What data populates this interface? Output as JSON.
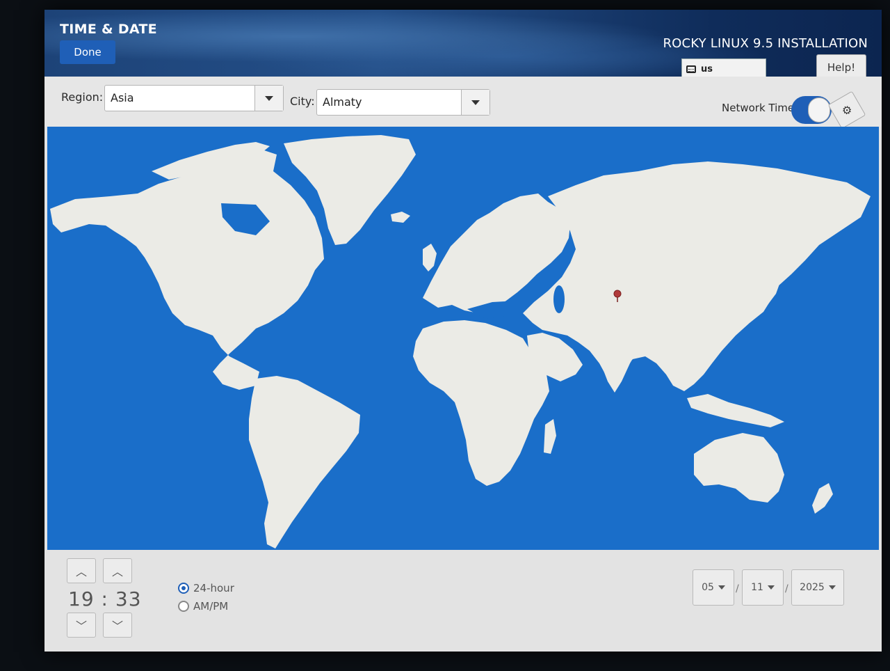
{
  "header": {
    "title": "TIME & DATE",
    "done_label": "Done",
    "product": "ROCKY LINUX 9.5 INSTALLATION",
    "keyboard_layout": "us",
    "help_label": "Help!"
  },
  "toolbar": {
    "region_label": "Region:",
    "region_value": "Asia",
    "city_label": "City:",
    "city_value": "Almaty",
    "network_time_label": "Network Time",
    "network_time_on": true
  },
  "map": {
    "ocean_color": "#1a6ec9",
    "land_color": "#ebebe6",
    "marker_color": "#b03a3a",
    "marker_icon": "location-pin-icon"
  },
  "time": {
    "hour": "19",
    "separator": ":",
    "minute": "33",
    "format_24h_label": "24-hour",
    "format_ampm_label": "AM/PM",
    "selected_format": "24-hour"
  },
  "date": {
    "month": "05",
    "day": "11",
    "year": "2025",
    "separator": "/"
  },
  "colors": {
    "accent": "#1f5fb7"
  }
}
